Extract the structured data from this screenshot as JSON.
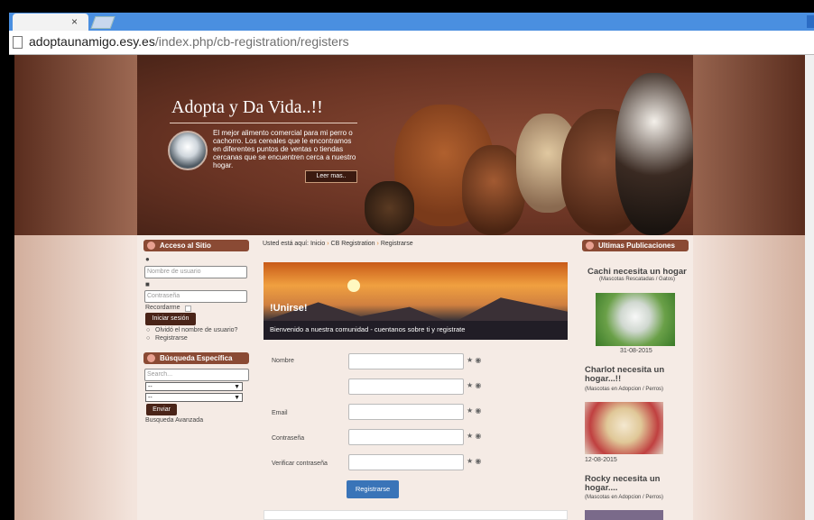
{
  "browser": {
    "tab_close": "×",
    "url_host": "adoptaunamigo.esy.es",
    "url_path": "/index.php/cb-registration/registers"
  },
  "banner": {
    "title": "Adopta y Da Vida..!!",
    "text": "El mejor alimento comercial para mi perro o cachorro. Los cereales que le encontramos en diferentes puntos de ventas o tiendas cercanas que se encuentren cerca a nuestro hogar.",
    "read_more": "Leer mas.."
  },
  "sidebar": {
    "login": {
      "heading": "Acceso al Sitio",
      "username_placeholder": "Nombre de usuario",
      "password_placeholder": "Contraseña",
      "remember": "Recordarme",
      "login_button": "Iniciar sesión",
      "forgot": "Olvidó el nombre de usuario?",
      "register": "Registrarse"
    },
    "search": {
      "heading": "Búsqueda Específica",
      "search_placeholder": "Search...",
      "select1": "--",
      "select2": "--",
      "submit": "Enviar",
      "advanced": "Busqueda Avanzada"
    }
  },
  "breadcrumb": {
    "prefix": "Usted está aquí:",
    "items": [
      "Inicio",
      "CB Registration",
      "Registrarse"
    ]
  },
  "hero": {
    "title": "!Unirse!",
    "subtitle": "Bienvenido a nuestra comunidad - cuentanos sobre ti y registrate"
  },
  "form": {
    "fields": [
      {
        "label": "Nombre"
      },
      {
        "label": ""
      },
      {
        "label": "Email"
      },
      {
        "label": "Contraseña"
      },
      {
        "label": "Verificar contraseña"
      }
    ],
    "required_marker": "★",
    "submit": "Registrarse"
  },
  "right": {
    "heading": "Ultimas Publicaciones",
    "posts": [
      {
        "title": "Cachi necesita un hogar",
        "category": "(Mascotas Rescatadas / Gatos)",
        "date": "31-08-2015"
      },
      {
        "title": "Charlot necesita un hogar...!!",
        "category": "(Mascotas en Adopcion / Perros)",
        "date": "12-08-2015"
      },
      {
        "title": "Rocky necesita un hogar....",
        "category": "(Mascotas en Adopcion / Perros)",
        "date": ""
      }
    ]
  },
  "colors": {
    "accent_brown": "#8a4a34",
    "button_blue": "#3a74b8",
    "chrome_blue": "#4a8fe0"
  }
}
